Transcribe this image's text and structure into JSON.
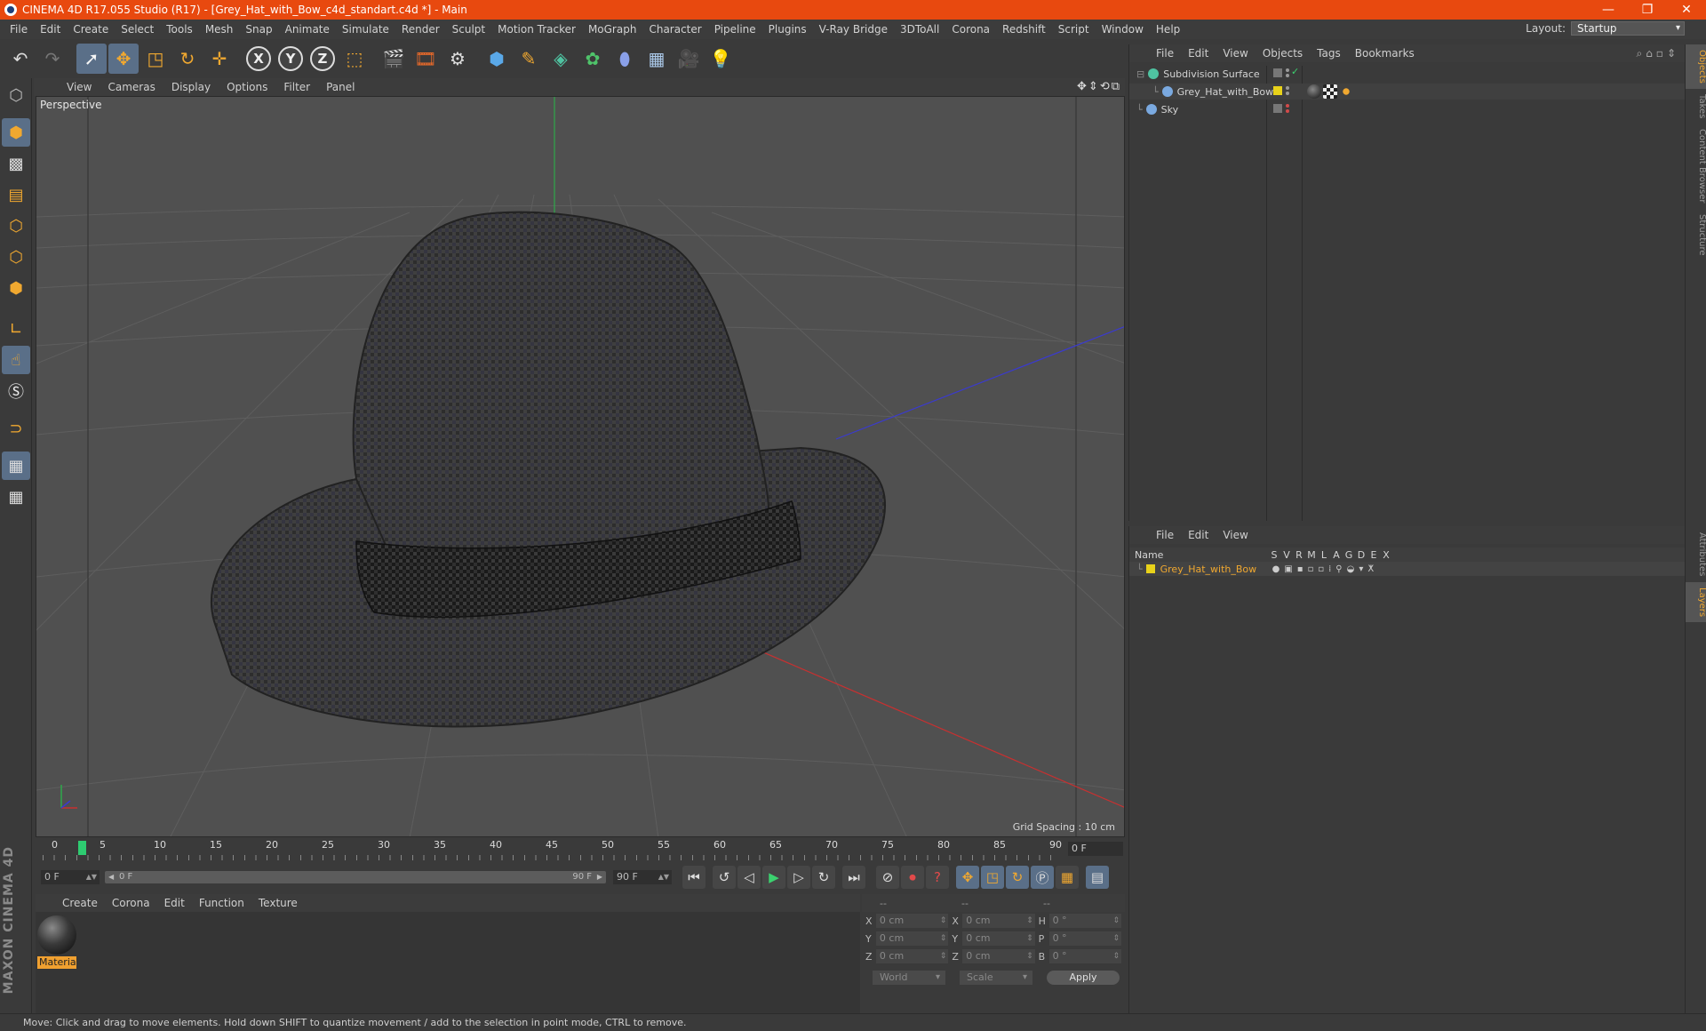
{
  "window": {
    "title": "CINEMA 4D R17.055 Studio (R17) - [Grey_Hat_with_Bow_c4d_standart.c4d *] - Main",
    "controls": [
      "—",
      "❐",
      "✕"
    ]
  },
  "menubar": {
    "items": [
      "File",
      "Edit",
      "Create",
      "Select",
      "Tools",
      "Mesh",
      "Snap",
      "Animate",
      "Simulate",
      "Render",
      "Sculpt",
      "Motion Tracker",
      "MoGraph",
      "Character",
      "Pipeline",
      "Plugins",
      "V-Ray Bridge",
      "3DToAll",
      "Corona",
      "Redshift",
      "Script",
      "Window",
      "Help"
    ],
    "layout_label": "Layout:",
    "layout_value": "Startup"
  },
  "toolbar": {
    "icons": [
      "undo-icon",
      "redo-icon",
      "select-arrow-icon",
      "move-icon",
      "scale-icon",
      "rotate-icon",
      "live-select-icon",
      "x-axis-icon",
      "y-axis-icon",
      "z-axis-icon",
      "coordinate-system-icon",
      "render-view-icon",
      "render-picture-viewer-icon",
      "edit-render-settings-icon",
      "cube-icon",
      "pen-icon",
      "subdivision-icon",
      "array-icon",
      "deformer-icon",
      "floor-icon",
      "camera-icon",
      "light-icon"
    ],
    "axis_x": "X",
    "axis_y": "Y",
    "axis_z": "Z"
  },
  "viewport": {
    "menu": [
      "View",
      "Cameras",
      "Display",
      "Options",
      "Filter",
      "Panel"
    ],
    "label": "Perspective",
    "grid_spacing": "Grid Spacing : 10 cm"
  },
  "timeline": {
    "ticks": [
      "0",
      "5",
      "10",
      "15",
      "20",
      "25",
      "30",
      "35",
      "40",
      "45",
      "50",
      "55",
      "60",
      "65",
      "70",
      "75",
      "80",
      "85",
      "90"
    ],
    "current_frame": "0 F",
    "start_field": "0 F",
    "range_start": "0 F",
    "range_end": "90 F",
    "end_field": "90 F"
  },
  "material_manager": {
    "menu": [
      "Create",
      "Corona",
      "Edit",
      "Function",
      "Texture"
    ],
    "material_name": "Materia"
  },
  "coordinates": {
    "headers": [
      "--",
      "--",
      "--"
    ],
    "rows": [
      {
        "a1": "X",
        "v1": "0 cm",
        "a2": "X",
        "v2": "0 cm",
        "a3": "H",
        "v3": "0 °"
      },
      {
        "a1": "Y",
        "v1": "0 cm",
        "a2": "Y",
        "v2": "0 cm",
        "a3": "P",
        "v3": "0 °"
      },
      {
        "a1": "Z",
        "v1": "0 cm",
        "a2": "Z",
        "v2": "0 cm",
        "a3": "B",
        "v3": "0 °"
      }
    ],
    "mode": "World",
    "transform": "Scale",
    "apply": "Apply"
  },
  "object_manager": {
    "menu": [
      "File",
      "Edit",
      "View",
      "Objects",
      "Tags",
      "Bookmarks"
    ],
    "objects": [
      {
        "name": "Subdivision Surface",
        "icon_color": "#4fc3a1"
      },
      {
        "name": "Grey_Hat_with_Bow",
        "icon_color": "#7aa9e0"
      },
      {
        "name": "Sky",
        "icon_color": "#7aa9e0"
      }
    ]
  },
  "layer_manager": {
    "menu": [
      "File",
      "Edit",
      "View"
    ],
    "columns": [
      "Name",
      "S",
      "V",
      "R",
      "M",
      "L",
      "A",
      "G",
      "D",
      "E",
      "X"
    ],
    "layer_name": "Grey_Hat_with_Bow"
  },
  "side_tabs": [
    "Objects",
    "Takes",
    "Content Browser",
    "Structure",
    "Attributes",
    "Layers"
  ],
  "status_text": "Move: Click and drag to move elements. Hold down SHIFT to quantize movement / add to the selection in point mode, CTRL to remove.",
  "branding": "MAXON CINEMA 4D",
  "colors": {
    "titlebar": "#e8490f",
    "accent_orange": "#f0a830",
    "active_blue": "#5a6f88",
    "play_green": "#3bd16f"
  }
}
